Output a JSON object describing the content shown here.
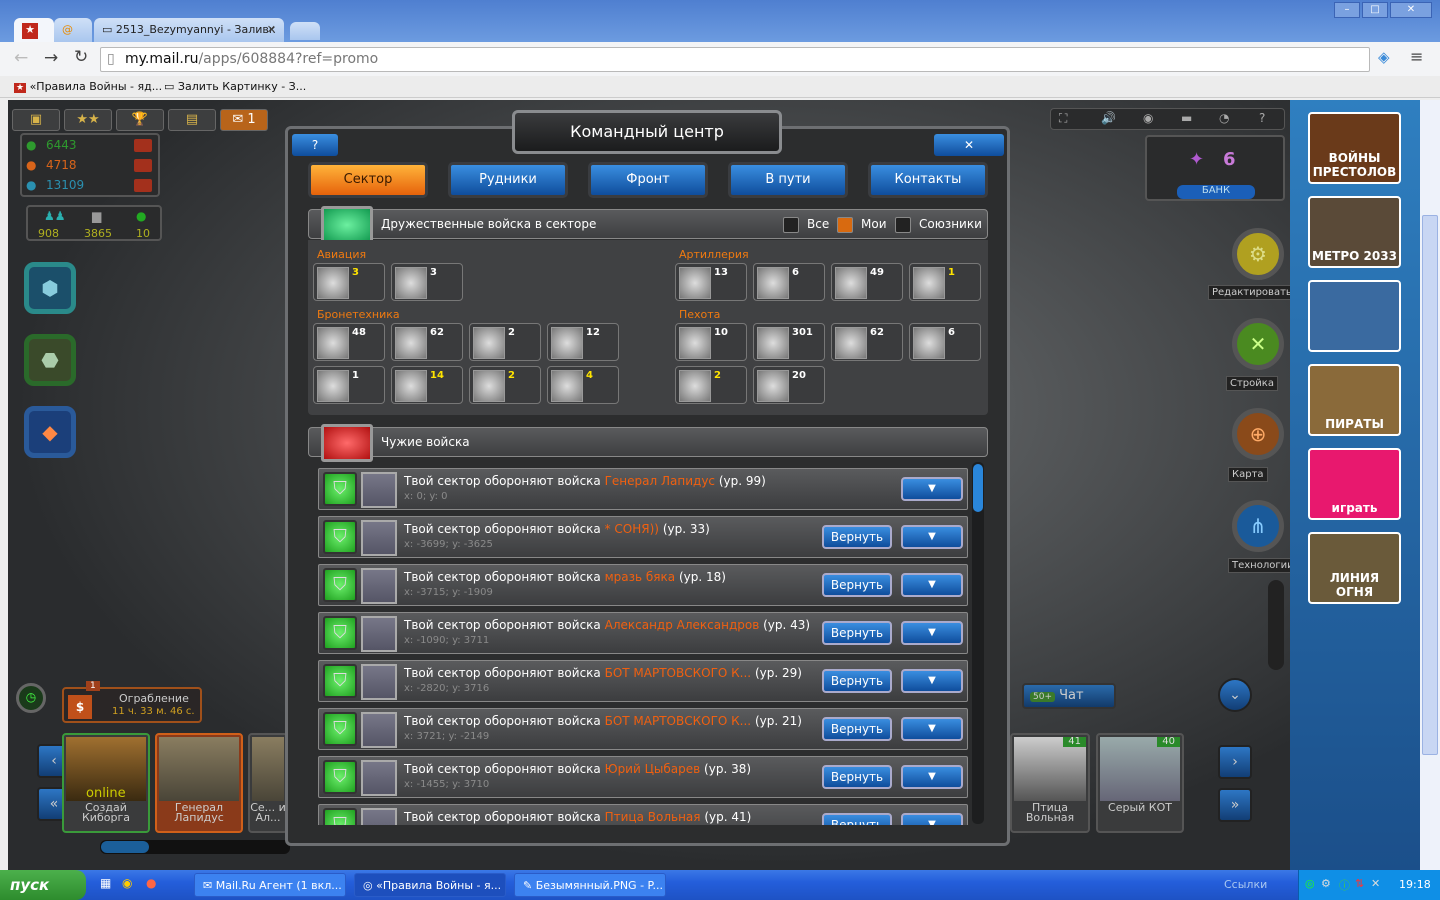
{
  "browser": {
    "tabs": [
      {
        "label": "",
        "icon": "star-app-icon"
      },
      {
        "label": "",
        "icon": "mail-agent-icon"
      },
      {
        "label": "2513_Bezymyannyi - Заливк",
        "icon": "image-icon"
      }
    ],
    "url_host": "my.mail.ru",
    "url_path": "/apps/608884?ref=promo",
    "bookmarks": [
      "«Правила Войны - яд...",
      "Залить Картинку - З..."
    ]
  },
  "hud": {
    "resources": [
      {
        "value": "6443",
        "color": "#2e9a2e",
        "icon": "radiation-icon"
      },
      {
        "value": "4718",
        "color": "#d8641a",
        "icon": "titanium-icon"
      },
      {
        "value": "13109",
        "color": "#2a90b0",
        "icon": "dollar-icon"
      }
    ],
    "stats": [
      "908",
      "3865",
      "10"
    ],
    "mail_count": "1",
    "crystals": "6",
    "bank_label": "БАНК",
    "side_buttons": [
      "Редактировать",
      "Стройка",
      "Карта",
      "Технологии"
    ],
    "robbery": {
      "badge": "1",
      "title": "Ограбление",
      "timer": "11 ч. 33 м. 46 с."
    },
    "chat_label": "Чат",
    "chat_badge": "50+",
    "friends": [
      {
        "name": "Создай Киборга",
        "tag": "online"
      },
      {
        "name": "Генерал Лапидус"
      },
      {
        "name": "Се... и Ал..."
      }
    ],
    "friends_right": [
      {
        "name": "Птица Вольная",
        "level": "41"
      },
      {
        "name": "Серый КОТ",
        "level": "40"
      }
    ]
  },
  "dialog": {
    "title": "Командный центр",
    "help": "?",
    "close": "✕",
    "tabs": [
      {
        "label": "Сектор",
        "active": true
      },
      {
        "label": "Рудники"
      },
      {
        "label": "Фронт"
      },
      {
        "label": "В пути"
      },
      {
        "label": "Контакты"
      }
    ],
    "friendly_header": "Дружественные войска в секторе",
    "filters": [
      {
        "label": "Все",
        "checked": false
      },
      {
        "label": "Мои",
        "checked": true
      },
      {
        "label": "Союзники",
        "checked": false
      }
    ],
    "categories": [
      {
        "name": "Авиация",
        "units": [
          {
            "count": "3",
            "own": true
          },
          {
            "count": "3",
            "own": false
          }
        ]
      },
      {
        "name": "Артиллерия",
        "units": [
          {
            "count": "13"
          },
          {
            "count": "6"
          },
          {
            "count": "49"
          },
          {
            "count": "1",
            "own": true
          }
        ]
      },
      {
        "name": "Бронетехника",
        "units": [
          {
            "count": "48"
          },
          {
            "count": "62"
          },
          {
            "count": "2"
          },
          {
            "count": "12"
          },
          {
            "count": "1"
          },
          {
            "count": "14",
            "own": true
          },
          {
            "count": "2",
            "own": true
          },
          {
            "count": "4",
            "own": true
          }
        ]
      },
      {
        "name": "Пехота",
        "units": [
          {
            "count": "10"
          },
          {
            "count": "301"
          },
          {
            "count": "62"
          },
          {
            "count": "6"
          },
          {
            "count": "2",
            "own": true
          },
          {
            "count": "20"
          }
        ]
      }
    ],
    "foreign_header": "Чужие войска",
    "return_label": "Вернуть",
    "rows": [
      {
        "prefix": "Твой сектор обороняют войска",
        "name": "Генерал Лапидус",
        "level": "(ур. 99)",
        "coords": "x: 0; y: 0",
        "can_return": false
      },
      {
        "prefix": "Твой сектор обороняют войска",
        "name": "* СОНЯ))",
        "level": "(ур. 33)",
        "coords": "x: -3699; y: -3625",
        "can_return": true
      },
      {
        "prefix": "Твой сектор обороняют войска",
        "name": "мразь бяка",
        "level": "(ур. 18)",
        "coords": "x: -3715; y: -1909",
        "can_return": true
      },
      {
        "prefix": "Твой сектор обороняют войска",
        "name": "Александр Александров",
        "level": "(ур. 43)",
        "coords": "x: -1090; y: 3711",
        "can_return": true
      },
      {
        "prefix": "Твой сектор обороняют войска",
        "name": "БОТ МАРТОВСКОГО К...",
        "level": "(ур. 29)",
        "coords": "x: -2820; y: 3716",
        "can_return": true
      },
      {
        "prefix": "Твой сектор обороняют войска",
        "name": "БОТ МАРТОВСКОГО К...",
        "level": "(ур. 21)",
        "coords": "x: 3721; y: -2149",
        "can_return": true
      },
      {
        "prefix": "Твой сектор обороняют войска",
        "name": "Юрий Цыбарев",
        "level": "(ур. 38)",
        "coords": "x: -1455; y: 3710",
        "can_return": true
      },
      {
        "prefix": "Твой сектор обороняют войска",
        "name": "Птица Вольная",
        "level": "(ур. 41)",
        "coords": "",
        "can_return": true
      }
    ]
  },
  "ads": [
    {
      "label": "ВОЙНЫ ПРЕСТОЛОВ",
      "bg": "#6a3a1a"
    },
    {
      "label": "МЕТРО 2033",
      "bg": "#5a4a38"
    },
    {
      "label": "",
      "bg": "#3a6aa0"
    },
    {
      "label": "ПИРАТЫ",
      "bg": "#8a6a3a"
    },
    {
      "label": "играть",
      "bg": "#e8186e"
    },
    {
      "label": "ЛИНИЯ ОГНЯ",
      "bg": "#6a5a3a"
    }
  ],
  "taskbar": {
    "start": "пуск",
    "items": [
      "Mail.Ru Агент (1 вкл...",
      "«Правила Войны - я...",
      "Безымянный.PNG - P..."
    ],
    "links": "Ссылки",
    "clock": "19:18"
  }
}
